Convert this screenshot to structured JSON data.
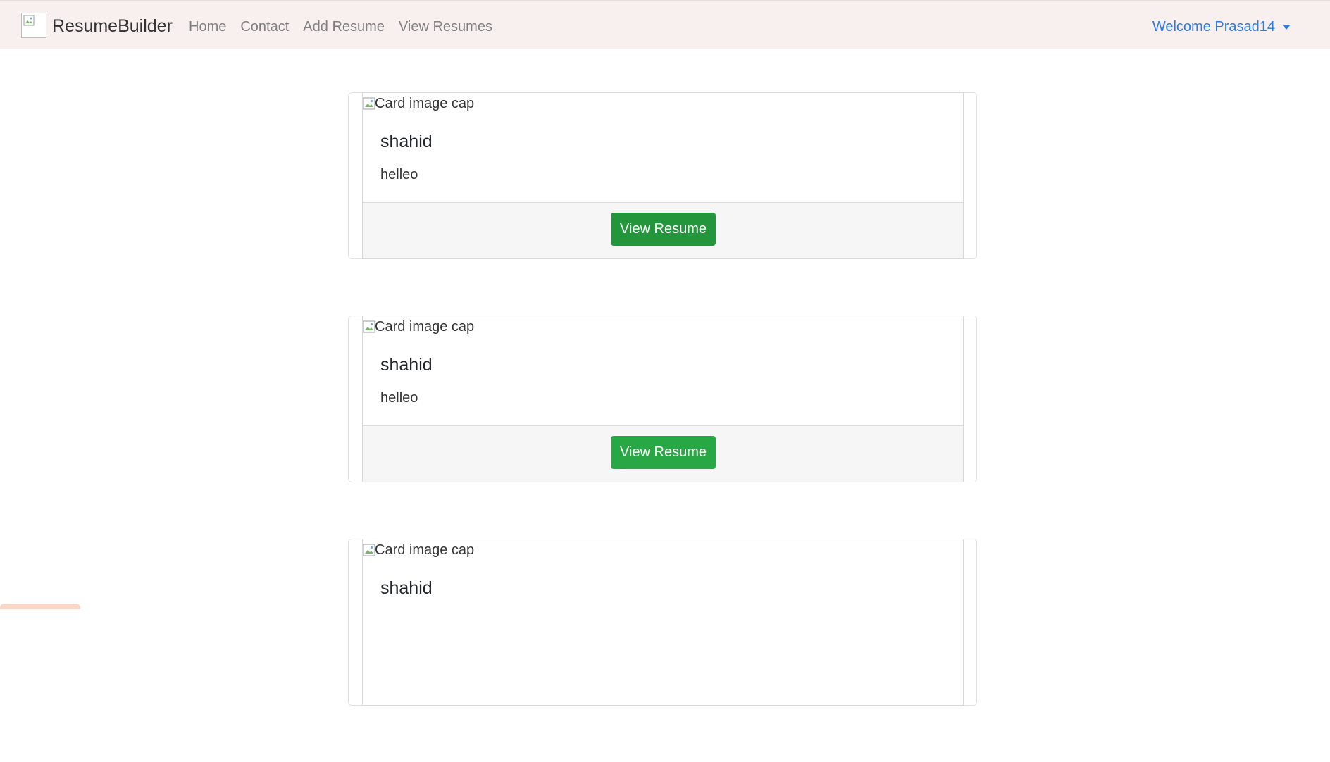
{
  "navbar": {
    "brand": "ResumeBuilder",
    "links": [
      "Home",
      "Contact",
      "Add Resume",
      "View Resumes"
    ],
    "user_menu_label": "Welcome Prasad14"
  },
  "cards": [
    {
      "image_alt": "Card image cap",
      "title": "shahid",
      "text": "helleo",
      "button_label": "View Resume"
    },
    {
      "image_alt": "Card image cap",
      "title": "shahid",
      "text": "helleo",
      "button_label": "View Resume"
    },
    {
      "image_alt": "Card image cap",
      "title": "shahid",
      "text": "",
      "button_label": ""
    }
  ],
  "colors": {
    "navbar_bg": "#f8efef",
    "brand_text": "#333333",
    "nav_link": "#808080",
    "user_link": "#2c7be5",
    "button_green": "#28a745",
    "card_footer_bg": "#f6f6f6"
  },
  "icons": {
    "brand_logo": "broken-image-icon",
    "card_image": "broken-image-icon",
    "user_menu_caret": "caret-down-icon"
  }
}
